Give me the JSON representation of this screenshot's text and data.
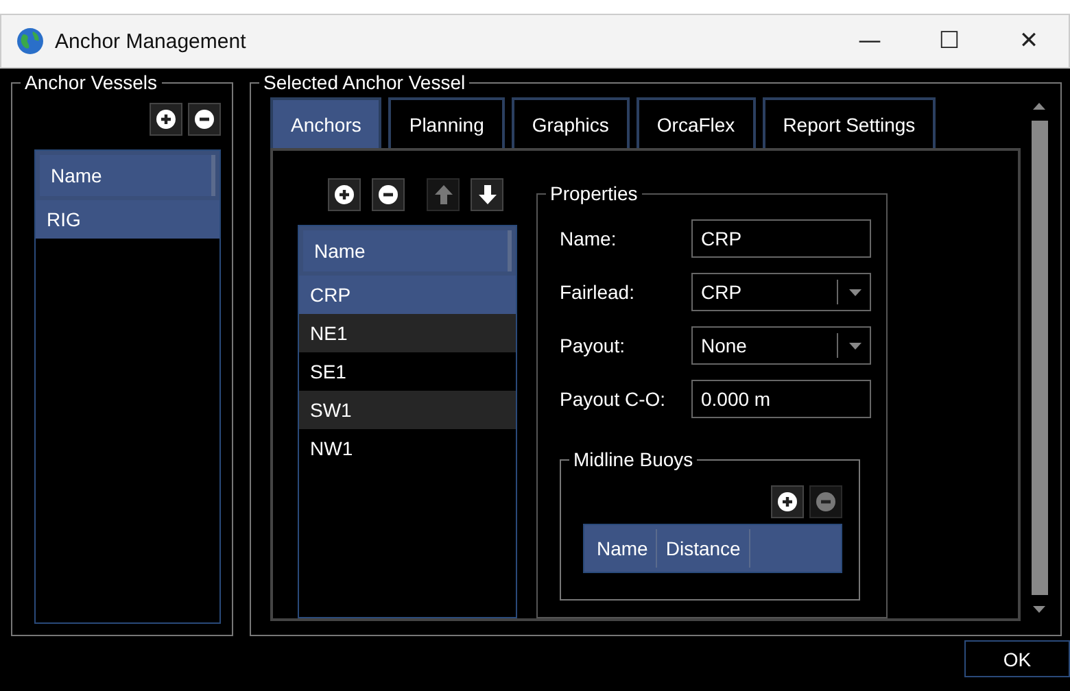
{
  "window": {
    "title": "Anchor Management",
    "controls": [
      "—",
      "☐",
      "✕"
    ]
  },
  "vessels": {
    "title": "Anchor Vessels",
    "buttons": [
      {
        "kind": "add",
        "disabled": false
      },
      {
        "kind": "remove",
        "disabled": false
      }
    ],
    "columns": [
      "Name"
    ],
    "rows": [
      {
        "name": "RIG",
        "selected": true
      }
    ]
  },
  "selected_vessel": {
    "title": "Selected Anchor Vessel",
    "tabs": [
      {
        "label": "Anchors",
        "selected": true
      },
      {
        "label": "Planning",
        "selected": false
      },
      {
        "label": "Graphics",
        "selected": false
      },
      {
        "label": "OrcaFlex",
        "selected": false
      },
      {
        "label": "Report Settings",
        "selected": false
      }
    ],
    "anchor_buttons": [
      {
        "kind": "add",
        "disabled": false
      },
      {
        "kind": "remove",
        "disabled": false
      },
      {
        "kind": "up",
        "disabled": true
      },
      {
        "kind": "down",
        "disabled": false
      }
    ],
    "anchors": {
      "columns": [
        "Name"
      ],
      "rows": [
        {
          "name": "CRP",
          "selected": true
        },
        {
          "name": "NE1",
          "selected": false
        },
        {
          "name": "SE1",
          "selected": false
        },
        {
          "name": "SW1",
          "selected": false
        },
        {
          "name": "NW1",
          "selected": false
        }
      ]
    },
    "properties": {
      "title": "Properties",
      "fields": [
        {
          "kind": "text",
          "label": "Name:",
          "value": "CRP"
        },
        {
          "kind": "dropdown",
          "label": "Fairlead:",
          "value": "CRP"
        },
        {
          "kind": "dropdown",
          "label": "Payout:",
          "value": "None"
        },
        {
          "kind": "text",
          "label": "Payout C-O:",
          "value": "0.000 m"
        }
      ],
      "midline_buoys": {
        "title": "Midline Buoys",
        "buttons": [
          {
            "kind": "add",
            "disabled": false
          },
          {
            "kind": "remove",
            "disabled": true
          }
        ],
        "columns": [
          "Name",
          "Distance"
        ]
      }
    }
  },
  "footer": {
    "ok": "OK"
  }
}
